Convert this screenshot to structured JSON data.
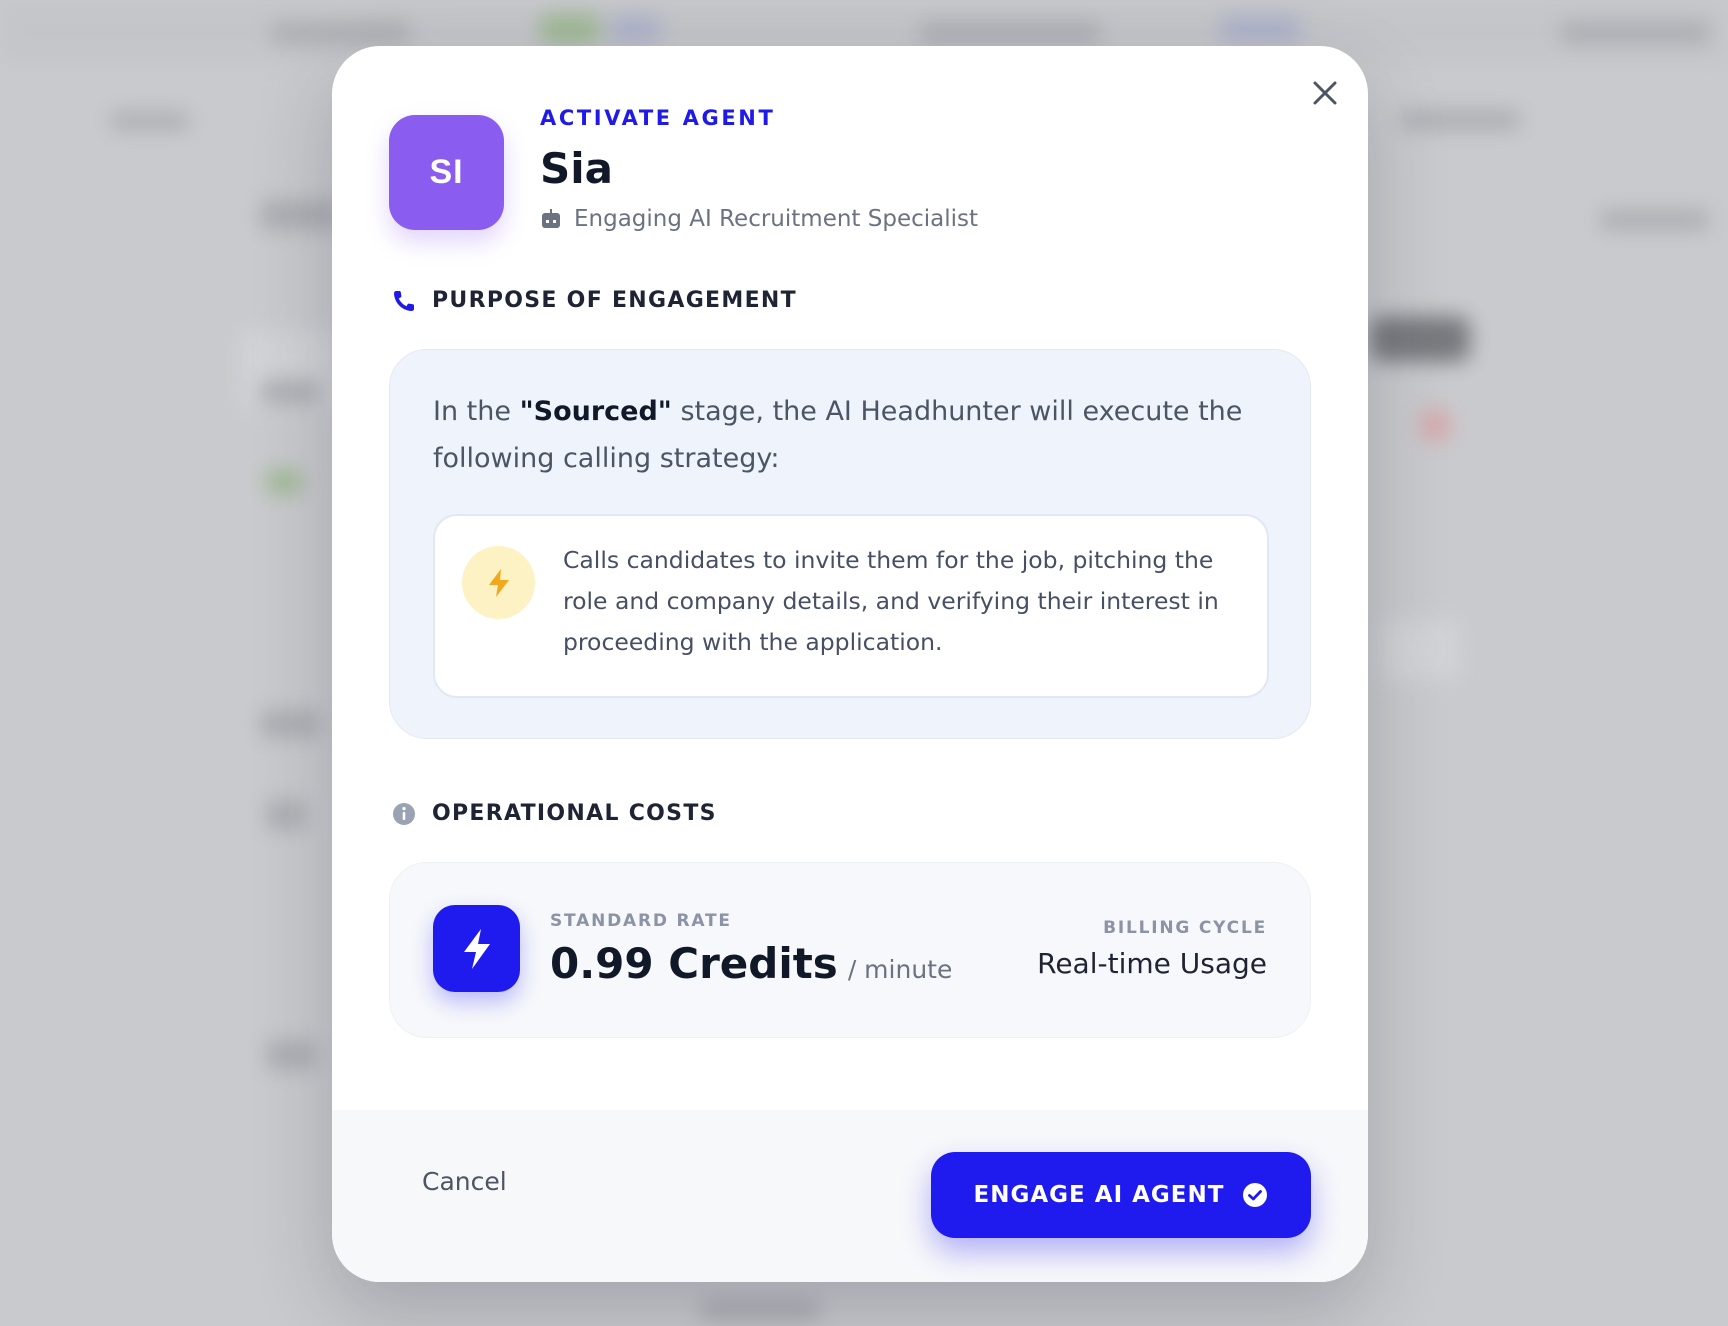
{
  "modal": {
    "eyebrow": "ACTIVATE AGENT",
    "avatar_initials": "SI",
    "agent_name": "Sia",
    "agent_role": "Engaging AI Recruitment Specialist",
    "close_icon": "close-icon"
  },
  "purpose": {
    "title": "PURPOSE OF ENGAGEMENT",
    "intro_before": "In the ",
    "stage_name": "\"Sourced\"",
    "intro_after": " stage, the AI Headhunter will execute the following calling strategy:",
    "strategy": "Calls candidates to invite them for the job, pitching the role and company details, and verifying their interest in proceeding with the application."
  },
  "costs": {
    "title": "OPERATIONAL COSTS",
    "rate_label": "STANDARD RATE",
    "rate_value": "0.99 Credits",
    "rate_unit": "/ minute",
    "billing_label": "BILLING CYCLE",
    "billing_value": "Real-time Usage"
  },
  "footer": {
    "cancel_label": "Cancel",
    "engage_label": "ENGAGE AI AGENT"
  },
  "colors": {
    "accent": "#1f1aee",
    "avatar": "#8b5cf0",
    "bolt_warning": "#f0a81c"
  }
}
